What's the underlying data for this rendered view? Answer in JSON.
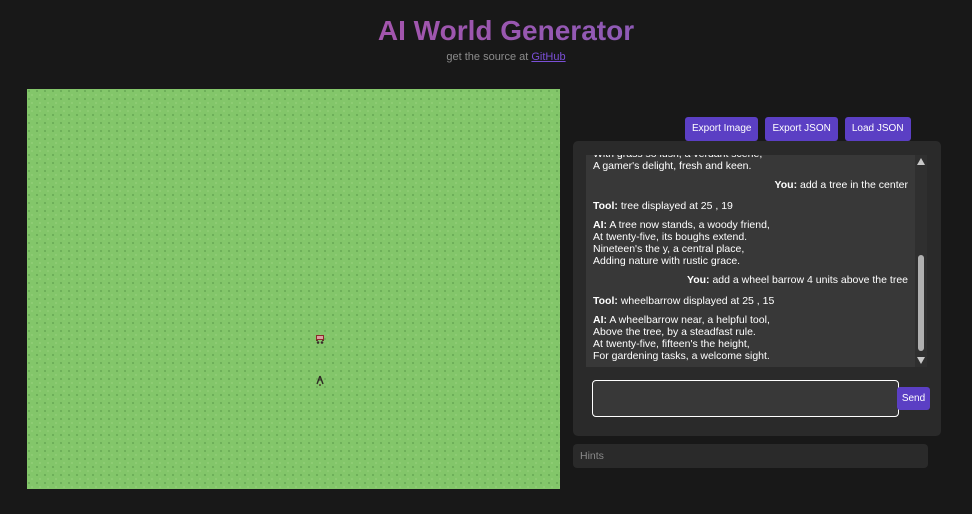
{
  "header": {
    "title": "AI World Generator",
    "subtitle_prefix": "get the source at ",
    "subtitle_link": "GitHub"
  },
  "colors": {
    "background": "#181818",
    "grass": "#83c66a",
    "accent": "#5b3fc4",
    "panel": "#2a2a2a",
    "chat_bg": "#383838"
  },
  "world": {
    "objects": [
      {
        "name": "wheelbarrow",
        "icon": "wheelbarrow-icon"
      },
      {
        "name": "tree",
        "icon": "tree-icon"
      }
    ]
  },
  "toolbar": {
    "export_image": "Export Image",
    "export_json": "Export JSON",
    "load_json": "Load JSON"
  },
  "chat": {
    "messages": [
      {
        "role": "ai",
        "speaker": "",
        "text": "With grass so lush, a verdant scene,\nA gamer's delight, fresh and keen."
      },
      {
        "role": "user",
        "speaker": "You:",
        "text": "add a tree in the center"
      },
      {
        "role": "tool",
        "speaker": "Tool:",
        "text": "tree displayed at 25 , 19"
      },
      {
        "role": "ai",
        "speaker": "AI:",
        "text": "A tree now stands, a woody friend,\nAt twenty-five, its boughs extend.\nNineteen's the y, a central place,\nAdding nature with rustic grace."
      },
      {
        "role": "user",
        "speaker": "You:",
        "text": "add a wheel barrow 4 units above the tree"
      },
      {
        "role": "tool",
        "speaker": "Tool:",
        "text": "wheelbarrow displayed at 25 , 15"
      },
      {
        "role": "ai",
        "speaker": "AI:",
        "text": "A wheelbarrow near, a helpful tool,\nAbove the tree, by a steadfast rule.\nAt twenty-five, fifteen's the height,\nFor gardening tasks, a welcome sight."
      }
    ],
    "input_value": "",
    "send_label": "Send"
  },
  "hints": {
    "label": "Hints"
  }
}
